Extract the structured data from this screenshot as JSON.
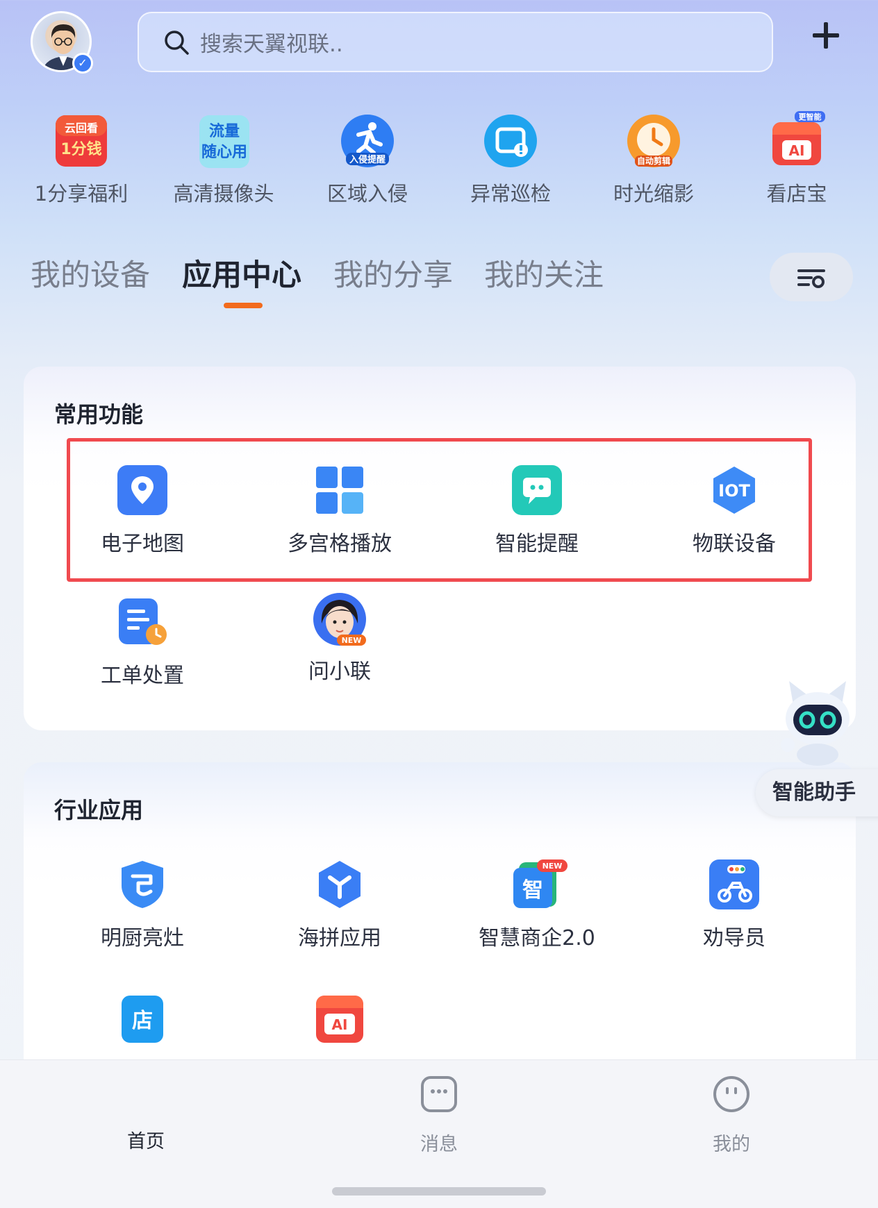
{
  "header": {
    "search_placeholder": "搜索天翼视联..",
    "add_icon": "plus-icon"
  },
  "shortcuts": [
    {
      "label": "1分享福利",
      "icon": "cloud-watch-promo-icon",
      "badge": "云回看 1分钱"
    },
    {
      "label": "高清摄像头",
      "icon": "data-plan-icon",
      "badge": "流量 随心用"
    },
    {
      "label": "区域入侵",
      "icon": "running-person-icon",
      "badge": "入侵提醒"
    },
    {
      "label": "异常巡检",
      "icon": "screen-alert-icon"
    },
    {
      "label": "时光缩影",
      "icon": "clock-timelapse-icon",
      "badge": "自动剪辑"
    },
    {
      "label": "看店宝",
      "icon": "ai-store-icon",
      "badge": "更智能"
    }
  ],
  "tabs": {
    "items": [
      "我的设备",
      "应用中心",
      "我的分享",
      "我的关注"
    ],
    "active": "应用中心"
  },
  "common": {
    "title": "常用功能",
    "items": [
      {
        "label": "电子地图",
        "icon": "map-pin-icon",
        "color": "#3d7cf6"
      },
      {
        "label": "多宫格播放",
        "icon": "grid-icon",
        "color": "#3a86f5"
      },
      {
        "label": "智能提醒",
        "icon": "chat-bubble-icon",
        "color": "#23c9b8"
      },
      {
        "label": "物联设备",
        "icon": "iot-hexagon-icon",
        "color": "#3e8bf6"
      },
      {
        "label": "工单处置",
        "icon": "work-order-icon",
        "color": "#3a7ef5"
      },
      {
        "label": "问小联",
        "icon": "assistant-avatar-icon",
        "badge": "NEW"
      }
    ]
  },
  "industry": {
    "title": "行业应用",
    "items": [
      {
        "label": "明厨亮灶",
        "icon": "chef-shield-icon",
        "color": "#3a8bf5"
      },
      {
        "label": "海拼应用",
        "icon": "hexagon-y-icon",
        "color": "#3a7ef5"
      },
      {
        "label": "智慧商企2.0",
        "icon": "smart-business-icon",
        "color": "#2f87f2",
        "badge": "NEW"
      },
      {
        "label": "劝导员",
        "icon": "scooter-icon",
        "color": "#3a7ef5"
      },
      {
        "label": "",
        "icon": "store-icon",
        "color": "#1e9cf0"
      },
      {
        "label": "",
        "icon": "ai-store-icon",
        "color": "#f0473f"
      }
    ]
  },
  "assistant": {
    "label": "智能助手"
  },
  "bottom_nav": {
    "items": [
      "首页",
      "消息",
      "我的"
    ],
    "active": "首页"
  },
  "colors": {
    "accent": "#f26b1d",
    "highlight": "#f04a4f"
  }
}
